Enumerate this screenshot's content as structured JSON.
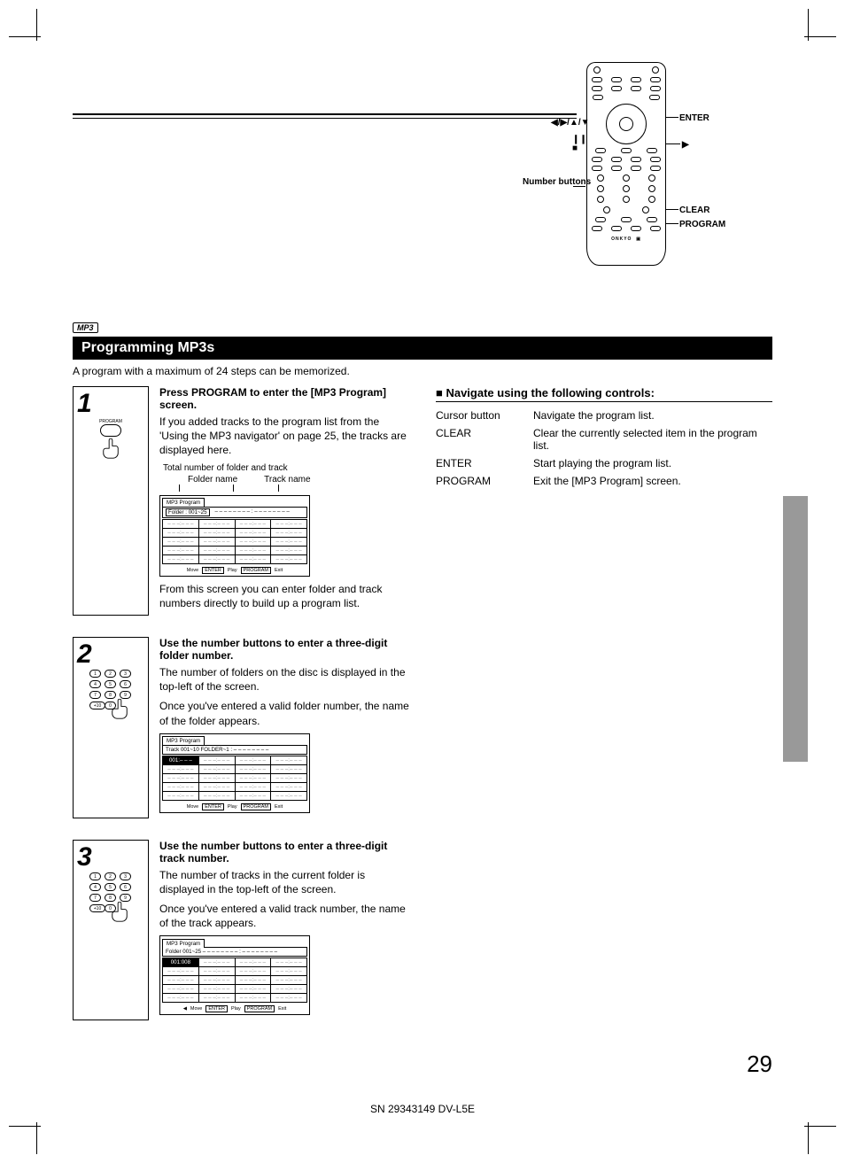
{
  "badge_mp3": "MP3",
  "section_title": "Programming MP3s",
  "intro": "A program with a maximum of 24 steps can be memorized.",
  "remote_labels": {
    "enter": "ENTER",
    "arrows": "◀/▶/▲/▼",
    "pause": "❙❙",
    "stop": "■",
    "play": "▶",
    "number": "Number buttons",
    "clear": "CLEAR",
    "program": "PROGRAM"
  },
  "steps": [
    {
      "num": "1",
      "icon_label": "PROGRAM",
      "heading": "Press PROGRAM to enter the [MP3 Program] screen.",
      "para1": "If you added tracks to the program list from the 'Using the MP3 navigator' on page 25, the tracks are displayed here.",
      "annot_total": "Total number of folder and track",
      "annot_folder": "Folder name",
      "annot_track": "Track name",
      "osd": {
        "title": "MP3 Program",
        "header": "Folder : 001~25",
        "header_right": "– – – – – – – – : – – – – – – – –",
        "footer": {
          "move": "Move",
          "enter": "ENTER",
          "play": "Play",
          "program": "PROGRAM",
          "exit": "Exit"
        }
      },
      "para2": "From this screen you can enter folder and track numbers directly to build up a program list."
    },
    {
      "num": "2",
      "heading": "Use the number buttons to enter a three-digit folder number.",
      "para1": "The number of folders on the disc is displayed in the top-left of the screen.",
      "para2": "Once you've entered a valid folder number, the name of the folder appears.",
      "osd": {
        "title": "MP3 Program",
        "header": "Track    001~10       FOLDER~1 : – – – – – – – –",
        "first_cell": "001:– – –",
        "footer": {
          "move": "Move",
          "enter": "ENTER",
          "play": "Play",
          "program": "PROGRAM",
          "exit": "Exit"
        }
      }
    },
    {
      "num": "3",
      "heading": "Use the number buttons to enter a three-digit track number.",
      "para1": "The number of tracks in the current folder is displayed in the top-left of the screen.",
      "para2": "Once you've entered a valid track number, the name of the track appears.",
      "osd": {
        "title": "MP3 Program",
        "header": "Folder   001~25       – – – – – – – – : – – – – – – – –",
        "first_cell": "001:008",
        "footer": {
          "left": "◀",
          "move": "Move",
          "enter": "ENTER",
          "play": "Play",
          "program": "PROGRAM",
          "exit": "Exit"
        }
      }
    }
  ],
  "controls_heading": "■ Navigate using the following controls:",
  "controls": [
    {
      "k": "Cursor button",
      "v": "Navigate the program list."
    },
    {
      "k": "CLEAR",
      "v": "Clear the currently selected item in the program list."
    },
    {
      "k": "ENTER",
      "v": "Start playing the program list."
    },
    {
      "k": "PROGRAM",
      "v": "Exit the [MP3 Program] screen."
    }
  ],
  "page_number": "29",
  "footer_code": "SN 29343149 DV-L5E",
  "placeholder_cell": "– – –:– – –"
}
